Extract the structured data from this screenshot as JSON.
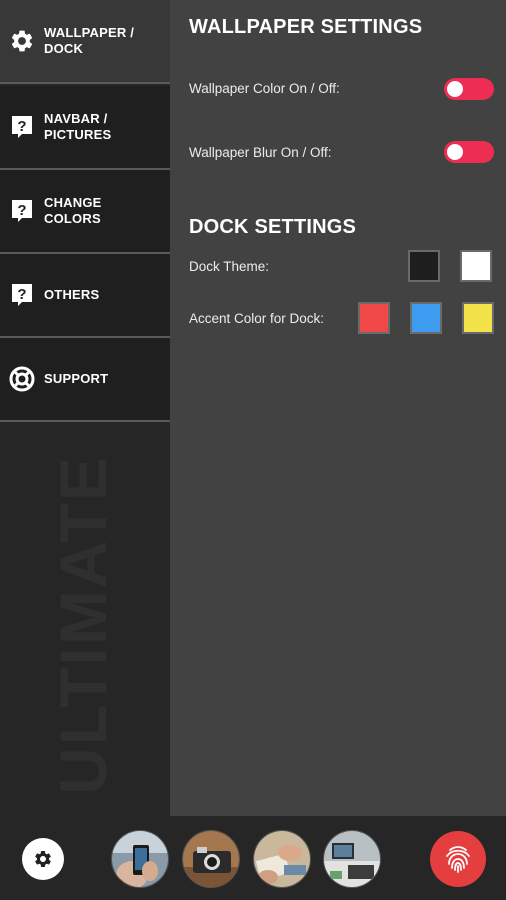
{
  "sidebar": {
    "items": [
      {
        "label": "WALLPAPER / DOCK",
        "icon": "gear-icon",
        "active": true
      },
      {
        "label": "NAVBAR / PICTURES",
        "icon": "help-chat-icon",
        "active": false
      },
      {
        "label": "CHANGE COLORS",
        "icon": "help-chat-icon",
        "active": false
      },
      {
        "label": "OTHERS",
        "icon": "help-chat-icon",
        "active": false
      },
      {
        "label": "SUPPORT",
        "icon": "lifebuoy-icon",
        "active": false
      }
    ],
    "watermark": "ULTIMATE"
  },
  "wallpaper": {
    "title": "WALLPAPER SETTINGS",
    "color_toggle_label": "Wallpaper Color On / Off:",
    "color_toggle_on": false,
    "blur_toggle_label": "Wallpaper Blur On / Off:",
    "blur_toggle_on": false
  },
  "dock": {
    "title": "DOCK SETTINGS",
    "theme_label": "Dock Theme:",
    "theme_swatches": [
      "#1e1e1e",
      "#ffffff"
    ],
    "accent_label": "Accent Color for Dock:",
    "accent_swatches": [
      "#f04747",
      "#3d9cf0",
      "#f4e24a"
    ]
  },
  "colors": {
    "toggle": "#ee2d52",
    "fingerprint_button": "#e53e3e"
  },
  "bottom_bar": {
    "settings_icon": "gear-icon",
    "thumbnails": [
      "phone-photo-thumbnail",
      "camera-photo-thumbnail",
      "hands-photo-thumbnail",
      "desk-photo-thumbnail"
    ],
    "fingerprint_icon": "fingerprint-icon"
  }
}
